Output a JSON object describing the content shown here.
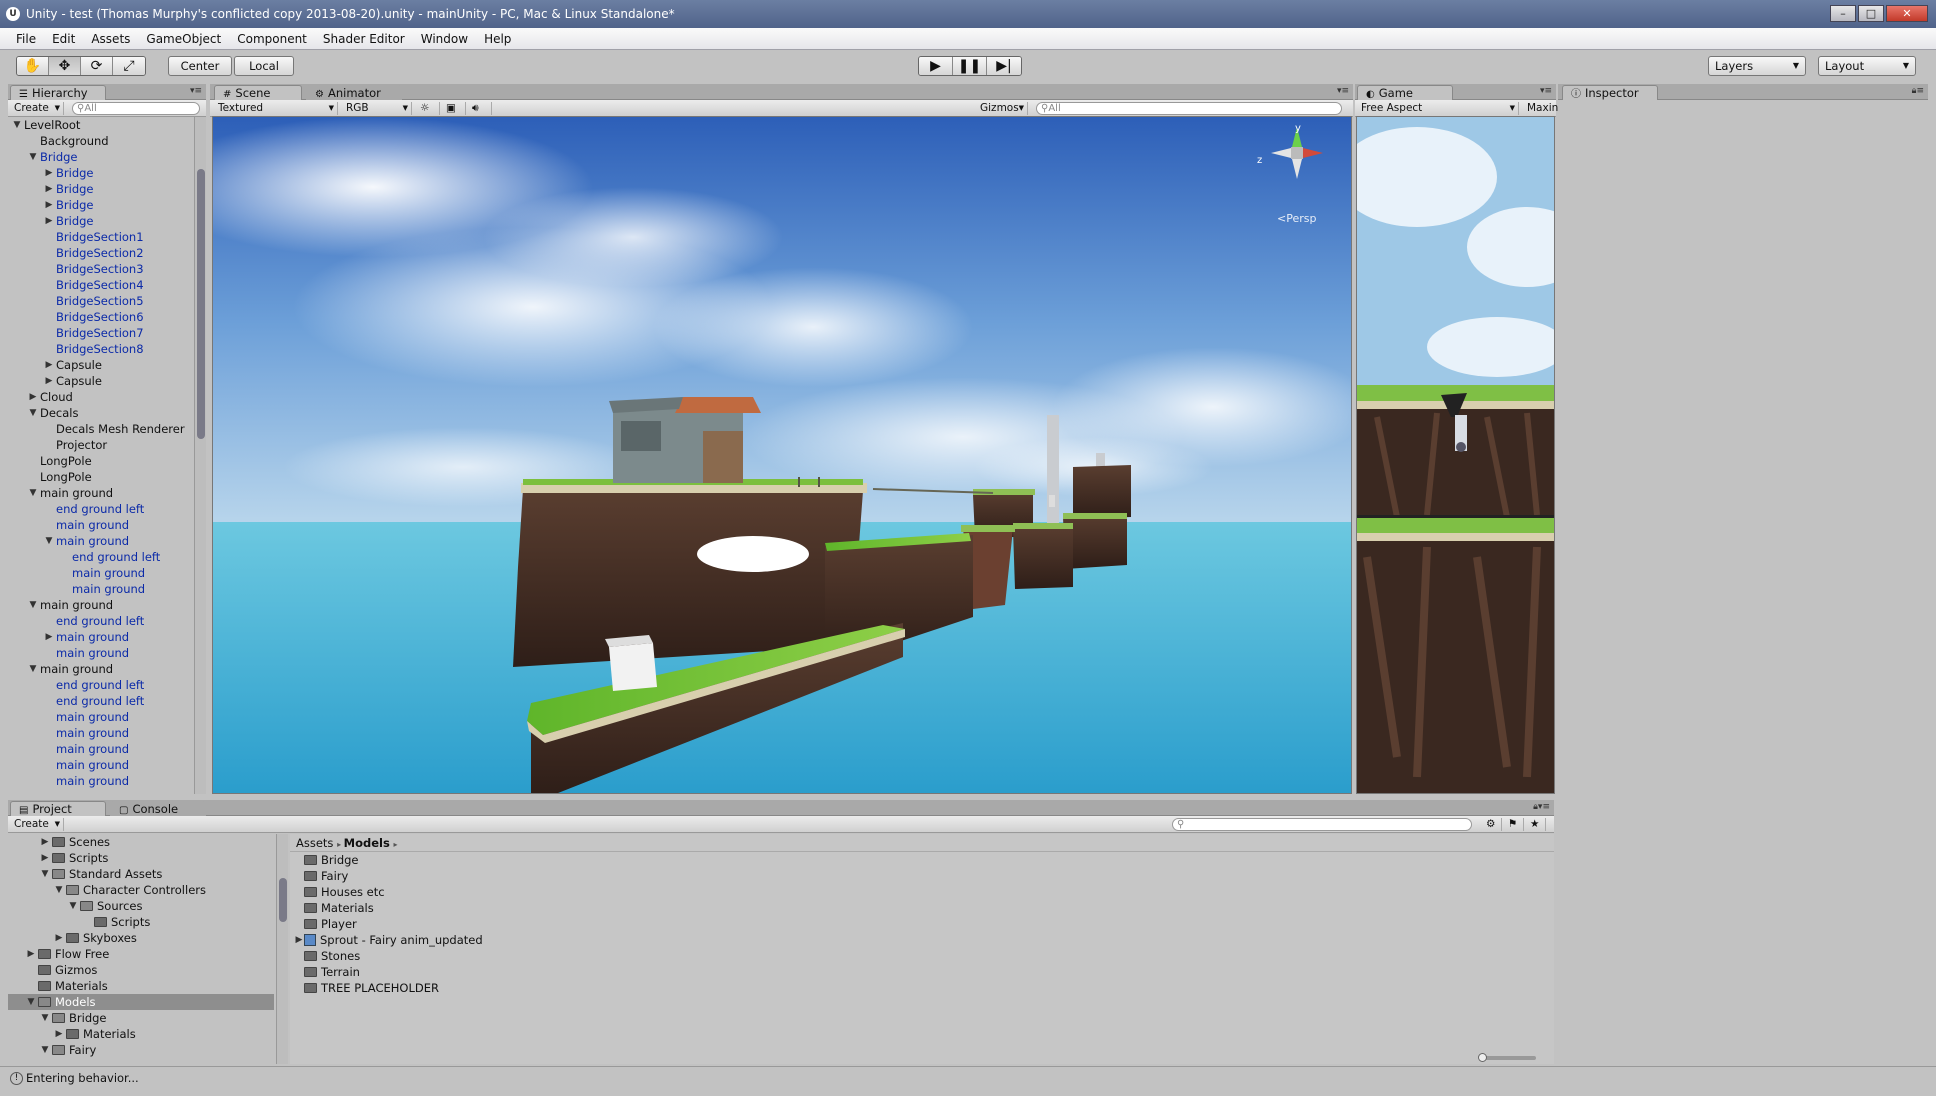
{
  "window": {
    "title": "Unity - test (Thomas Murphy's conflicted copy 2013-08-20).unity - mainUnity - PC, Mac & Linux Standalone*"
  },
  "menu": [
    "File",
    "Edit",
    "Assets",
    "GameObject",
    "Component",
    "Shader Editor",
    "Window",
    "Help"
  ],
  "toolbar": {
    "tools": [
      "hand-icon",
      "move-icon",
      "rotate-icon",
      "scale-icon"
    ],
    "pivot_label": "Center",
    "space_label": "Local",
    "play_icons": [
      "play-icon",
      "pause-icon",
      "step-icon"
    ],
    "layers_label": "Layers",
    "layout_label": "Layout"
  },
  "hierarchy": {
    "tab": "Hierarchy",
    "create": "Create",
    "search_placeholder": "All",
    "items": [
      {
        "label": "LevelRoot",
        "indent": 0,
        "fold": "open",
        "blue": false
      },
      {
        "label": "Background",
        "indent": 1,
        "fold": "",
        "blue": false
      },
      {
        "label": "Bridge",
        "indent": 1,
        "fold": "open",
        "blue": true
      },
      {
        "label": "Bridge",
        "indent": 2,
        "fold": "closed",
        "blue": true
      },
      {
        "label": "Bridge",
        "indent": 2,
        "fold": "closed",
        "blue": true
      },
      {
        "label": "Bridge",
        "indent": 2,
        "fold": "closed",
        "blue": true
      },
      {
        "label": "Bridge",
        "indent": 2,
        "fold": "closed",
        "blue": true
      },
      {
        "label": "BridgeSection1",
        "indent": 2,
        "fold": "",
        "blue": true
      },
      {
        "label": "BridgeSection2",
        "indent": 2,
        "fold": "",
        "blue": true
      },
      {
        "label": "BridgeSection3",
        "indent": 2,
        "fold": "",
        "blue": true
      },
      {
        "label": "BridgeSection4",
        "indent": 2,
        "fold": "",
        "blue": true
      },
      {
        "label": "BridgeSection5",
        "indent": 2,
        "fold": "",
        "blue": true
      },
      {
        "label": "BridgeSection6",
        "indent": 2,
        "fold": "",
        "blue": true
      },
      {
        "label": "BridgeSection7",
        "indent": 2,
        "fold": "",
        "blue": true
      },
      {
        "label": "BridgeSection8",
        "indent": 2,
        "fold": "",
        "blue": true
      },
      {
        "label": "Capsule",
        "indent": 2,
        "fold": "closed",
        "blue": false
      },
      {
        "label": "Capsule",
        "indent": 2,
        "fold": "closed",
        "blue": false
      },
      {
        "label": "Cloud",
        "indent": 1,
        "fold": "closed",
        "blue": false
      },
      {
        "label": "Decals",
        "indent": 1,
        "fold": "open",
        "blue": false
      },
      {
        "label": "Decals Mesh Renderer",
        "indent": 2,
        "fold": "",
        "blue": false
      },
      {
        "label": "Projector",
        "indent": 2,
        "fold": "",
        "blue": false
      },
      {
        "label": "LongPole",
        "indent": 1,
        "fold": "",
        "blue": false
      },
      {
        "label": "LongPole",
        "indent": 1,
        "fold": "",
        "blue": false
      },
      {
        "label": "main ground",
        "indent": 1,
        "fold": "open",
        "blue": false
      },
      {
        "label": "end ground left",
        "indent": 2,
        "fold": "",
        "blue": true
      },
      {
        "label": "main ground",
        "indent": 2,
        "fold": "",
        "blue": true
      },
      {
        "label": "main ground",
        "indent": 2,
        "fold": "open",
        "blue": true
      },
      {
        "label": "end ground left",
        "indent": 3,
        "fold": "",
        "blue": true
      },
      {
        "label": "main ground",
        "indent": 3,
        "fold": "",
        "blue": true
      },
      {
        "label": "main ground",
        "indent": 3,
        "fold": "",
        "blue": true
      },
      {
        "label": "main ground",
        "indent": 1,
        "fold": "open",
        "blue": false
      },
      {
        "label": "end ground left",
        "indent": 2,
        "fold": "",
        "blue": true
      },
      {
        "label": "main ground",
        "indent": 2,
        "fold": "closed",
        "blue": true
      },
      {
        "label": "main ground",
        "indent": 2,
        "fold": "",
        "blue": true
      },
      {
        "label": "main ground",
        "indent": 1,
        "fold": "open",
        "blue": false
      },
      {
        "label": "end ground left",
        "indent": 2,
        "fold": "",
        "blue": true
      },
      {
        "label": "end ground left",
        "indent": 2,
        "fold": "",
        "blue": true
      },
      {
        "label": "main ground",
        "indent": 2,
        "fold": "",
        "blue": true
      },
      {
        "label": "main ground",
        "indent": 2,
        "fold": "",
        "blue": true
      },
      {
        "label": "main ground",
        "indent": 2,
        "fold": "",
        "blue": true
      },
      {
        "label": "main ground",
        "indent": 2,
        "fold": "",
        "blue": true
      },
      {
        "label": "main ground",
        "indent": 2,
        "fold": "",
        "blue": true
      }
    ]
  },
  "scene": {
    "tab": "Scene",
    "tab2": "Animator",
    "render_mode": "Textured",
    "channel": "RGB",
    "gizmos": "Gizmos",
    "search_placeholder": "All",
    "gizmo_axis_y": "y",
    "gizmo_axis_z": "z",
    "persp_label": "Persp"
  },
  "game": {
    "tab": "Game",
    "aspect": "Free Aspect",
    "maximize": "Maxin"
  },
  "inspector": {
    "tab": "Inspector"
  },
  "project": {
    "tab": "Project",
    "tab2": "Console",
    "create": "Create",
    "breadcrumb_root": "Assets",
    "breadcrumb_current": "Models",
    "tree": [
      {
        "label": "Scenes",
        "indent": 2,
        "fold": "closed",
        "selected": false
      },
      {
        "label": "Scripts",
        "indent": 2,
        "fold": "closed",
        "selected": false
      },
      {
        "label": "Standard Assets",
        "indent": 2,
        "fold": "open",
        "selected": false
      },
      {
        "label": "Character Controllers",
        "indent": 3,
        "fold": "open",
        "selected": false
      },
      {
        "label": "Sources",
        "indent": 4,
        "fold": "open",
        "selected": false
      },
      {
        "label": "Scripts",
        "indent": 5,
        "fold": "",
        "selected": false
      },
      {
        "label": "Skyboxes",
        "indent": 3,
        "fold": "closed",
        "selected": false
      },
      {
        "label": "Flow Free",
        "indent": 1,
        "fold": "closed",
        "selected": false
      },
      {
        "label": "Gizmos",
        "indent": 1,
        "fold": "",
        "selected": false
      },
      {
        "label": "Materials",
        "indent": 1,
        "fold": "",
        "selected": false
      },
      {
        "label": "Models",
        "indent": 1,
        "fold": "open",
        "selected": true
      },
      {
        "label": "Bridge",
        "indent": 2,
        "fold": "open",
        "selected": false
      },
      {
        "label": "Materials",
        "indent": 3,
        "fold": "closed",
        "selected": false
      },
      {
        "label": "Fairy",
        "indent": 2,
        "fold": "open",
        "selected": false
      }
    ],
    "files": [
      {
        "label": "Bridge",
        "kind": "folder"
      },
      {
        "label": "Fairy",
        "kind": "folder"
      },
      {
        "label": "Houses etc",
        "kind": "folder"
      },
      {
        "label": "Materials",
        "kind": "folder"
      },
      {
        "label": "Player",
        "kind": "folder"
      },
      {
        "label": "Sprout - Fairy anim_updated",
        "kind": "model"
      },
      {
        "label": "Stones",
        "kind": "folder"
      },
      {
        "label": "Terrain",
        "kind": "folder"
      },
      {
        "label": "TREE PLACEHOLDER",
        "kind": "folder"
      }
    ]
  },
  "status": {
    "message": "Entering behavior..."
  },
  "colors": {
    "link_blue": "#0b2aa8",
    "selection": "#8e8e8e",
    "sky_top": "#3d6fc2",
    "sea": "#4fb6d8",
    "grass": "#5fb52a"
  }
}
